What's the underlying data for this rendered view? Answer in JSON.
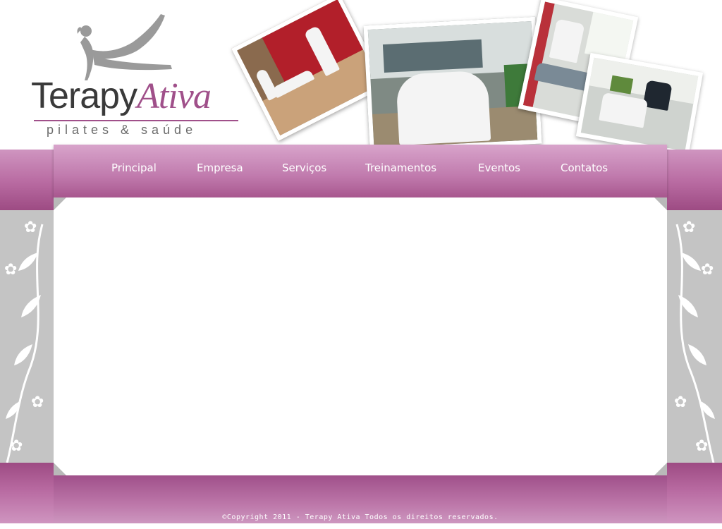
{
  "logo": {
    "word_part1": "Terapy",
    "word_part2": "Ativa",
    "subtitle": "pilates & saúde",
    "figure_icon": "pilates-silhouette-icon",
    "brand_color": "#a0508a",
    "dark_color": "#3a3a3a"
  },
  "photos": [
    {
      "name": "massage-room-photo"
    },
    {
      "name": "team-group-photo"
    },
    {
      "name": "therapy-session-photo"
    },
    {
      "name": "rehab-exercise-photo"
    }
  ],
  "nav": {
    "items": [
      {
        "label": "Principal"
      },
      {
        "label": "Empresa"
      },
      {
        "label": "Serviços"
      },
      {
        "label": "Treinamentos"
      },
      {
        "label": "Eventos"
      },
      {
        "label": "Contatos"
      }
    ],
    "color": "#c07aad"
  },
  "footer": {
    "copyright_symbol": "©",
    "copyright_text": "Copyright  2011 - Terapy Ativa Todos os direitos reservados."
  },
  "colors": {
    "side_gray": "#c4c4c4",
    "pink_light": "#d8a4cb",
    "pink_dark": "#9d4b83"
  }
}
